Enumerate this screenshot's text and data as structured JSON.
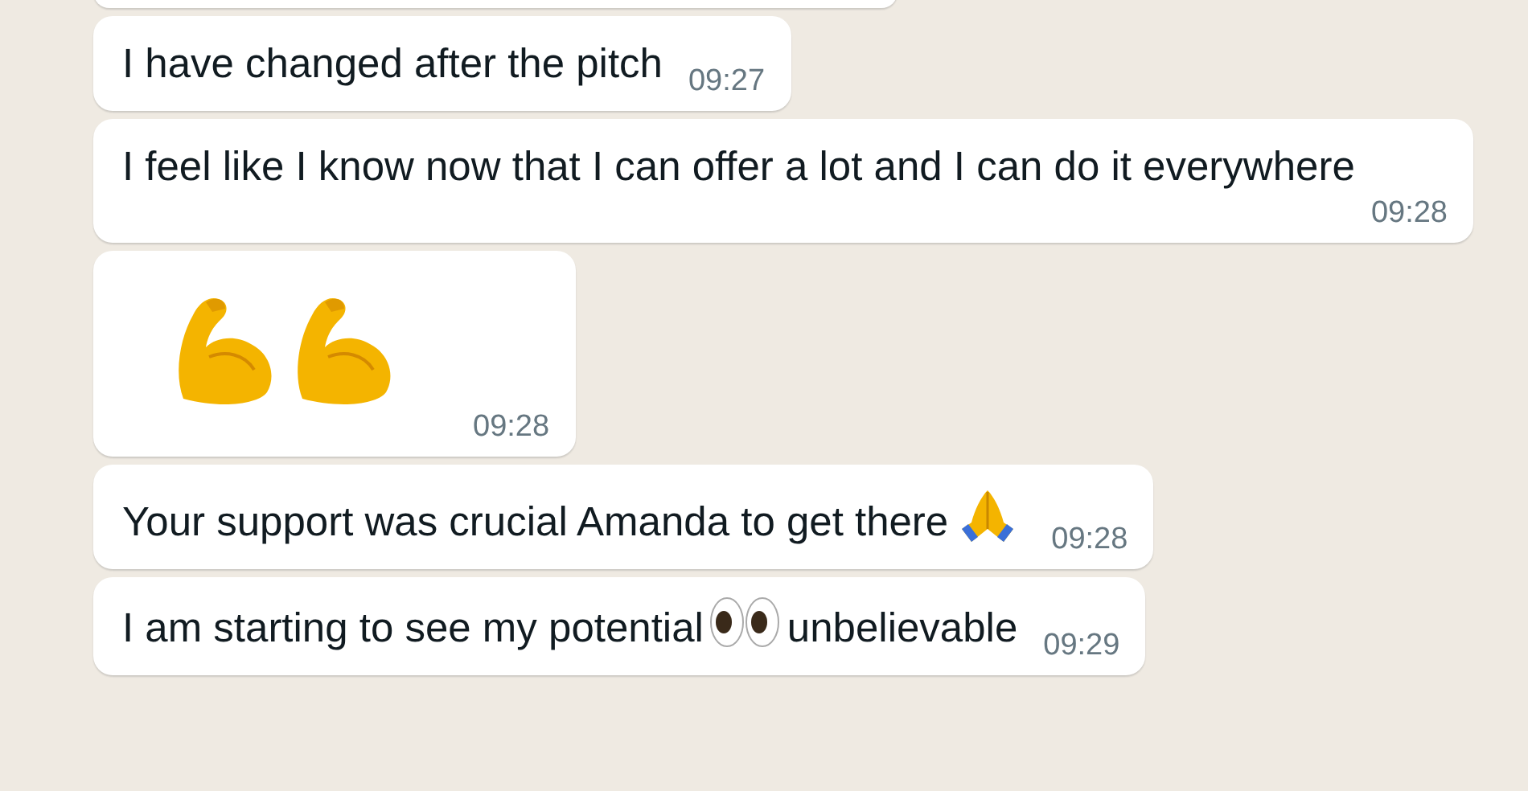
{
  "messages": [
    {
      "kind": "partial"
    },
    {
      "kind": "text",
      "text": "I have changed after the pitch",
      "time": "09:27"
    },
    {
      "kind": "text",
      "text": "I feel like I know now that I can offer a lot and I can do it everywhere",
      "time": "09:28"
    },
    {
      "kind": "emoji_only",
      "time": "09:28"
    },
    {
      "kind": "text_with_hands",
      "text": "Your support was crucial Amanda to get there",
      "time": "09:28"
    },
    {
      "kind": "text_with_eyes",
      "text": "I am starting to see my potential",
      "text_after": "unbelievable",
      "time": "09:29"
    }
  ]
}
